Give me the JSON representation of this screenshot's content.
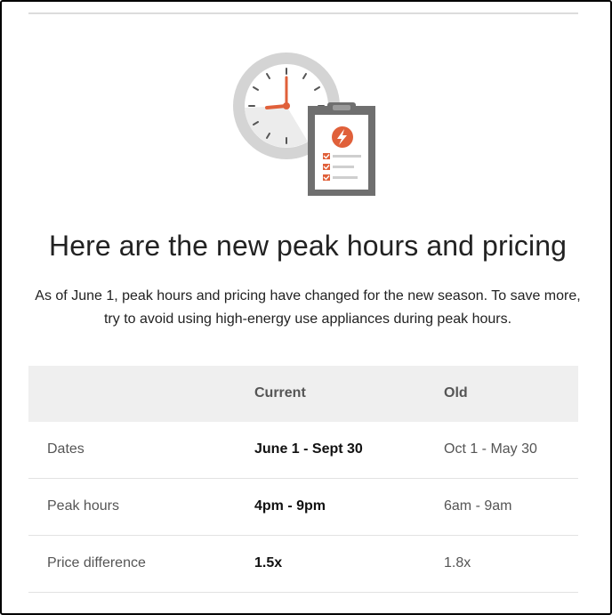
{
  "header": {
    "title": "Here are the new peak hours and pricing",
    "intro": "As of June 1, peak hours and pricing have changed for the new season. To save more, try to avoid using high-energy use appliances during peak hours."
  },
  "illustration": {
    "icons": [
      "clock-icon",
      "clipboard-icon",
      "lightning-bolt-icon",
      "checklist-icon"
    ],
    "colors": {
      "accent": "#e0603a",
      "clock_ring": "#d4d4d4",
      "clipboard_frame": "#6f6f6f"
    }
  },
  "table": {
    "headers": {
      "label": "",
      "current": "Current",
      "old": "Old"
    },
    "rows": [
      {
        "label": "Dates",
        "current": "June 1 - Sept 30",
        "old": "Oct 1 - May 30"
      },
      {
        "label": "Peak hours",
        "current": "4pm - 9pm",
        "old": "6am - 9am"
      },
      {
        "label": "Price difference",
        "current": "1.5x",
        "old": "1.8x"
      }
    ]
  }
}
